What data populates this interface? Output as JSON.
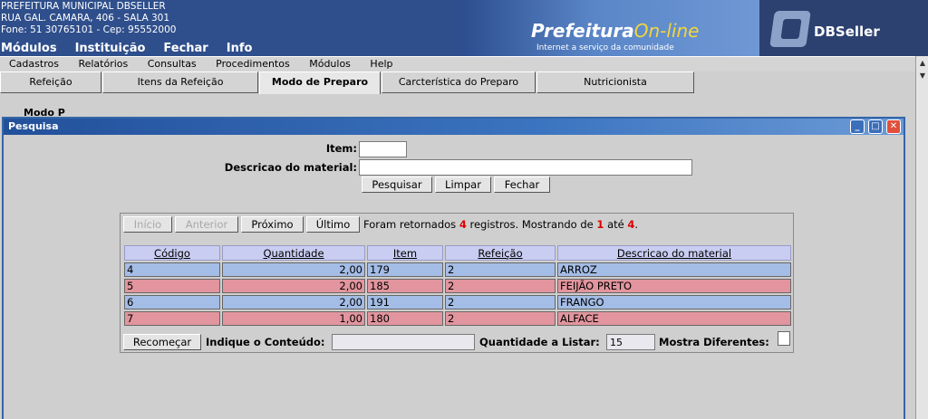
{
  "header": {
    "org_lines": [
      "PREFEITURA MUNICIPAL DBSELLER",
      "RUA GAL. CAMARA, 406 - SALA 301",
      "Fone: 51 30765101  -  Cep: 95552000"
    ],
    "main_menu": [
      "Módulos",
      "Instituição",
      "Fechar",
      "Info"
    ],
    "brand_a": "Prefeitura",
    "brand_b": "On-line",
    "tagline": "Internet a serviço da comunidade",
    "vendor": "DBSeller"
  },
  "menubar": [
    "Cadastros",
    "Relatórios",
    "Consultas",
    "Procedimentos",
    "Módulos",
    "Help"
  ],
  "tabs": [
    "Refeição",
    "Itens da Refeição",
    "Modo de Preparo",
    "Carcterística do Preparo",
    "Nutricionista"
  ],
  "active_tab": "Modo de Preparo",
  "behind_text": "Modo P",
  "modal": {
    "title": "Pesquisa",
    "item_label": "Item:",
    "item_value": "",
    "desc_label": "Descricao do material:",
    "desc_value": "",
    "btn_search": "Pesquisar",
    "btn_clear": "Limpar",
    "btn_close": "Fechar"
  },
  "pager": {
    "first": "Início",
    "prev": "Anterior",
    "next": "Próximo",
    "last": "Último",
    "info_a": "Foram retornados ",
    "count": "4",
    "info_b": " registros. Mostrando de ",
    "from": "1",
    "info_c": " até ",
    "to": "4",
    "info_d": "."
  },
  "table": {
    "headers": [
      "Código",
      "Quantidade",
      "Item",
      "Refeição",
      "Descricao do material"
    ],
    "rows": [
      [
        "4",
        "2,00",
        "179",
        "2",
        "ARROZ"
      ],
      [
        "5",
        "2,00",
        "185",
        "2",
        "FEIJÃO PRETO"
      ],
      [
        "6",
        "2,00",
        "191",
        "2",
        "FRANGO"
      ],
      [
        "7",
        "1,00",
        "180",
        "2",
        "ALFACE"
      ]
    ]
  },
  "footer": {
    "btn_restart": "Recomeçar",
    "content_label": "Indique o Conteúdo:",
    "content_value": "",
    "qty_label": "Quantidade a Listar:",
    "qty_value": "15",
    "diff_label": "Mostra Diferentes:"
  },
  "colors": {
    "header_bg": "#2f4f8c",
    "row_blue": "#a4bde6",
    "row_pink": "#e2959e",
    "header_cell": "#c9cdf1",
    "highlight_red": "#dd0000"
  }
}
